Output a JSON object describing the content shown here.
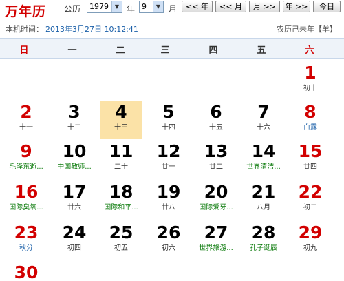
{
  "toolbar": {
    "brand": "万年历",
    "calendar_label": "公历",
    "year_value": "1979",
    "year_label": "年",
    "month_value": "9",
    "month_label": "月",
    "prev_year": "<< 年",
    "prev_month": "<< 月",
    "next_month": "月 >>",
    "next_year": "年 >>",
    "today": "今日"
  },
  "status": {
    "time_label": "本机时间：",
    "time_value": "2013年3月27日 10:12:41",
    "lunar_year": "农历己未年【羊】"
  },
  "weekdays": [
    "日",
    "一",
    "二",
    "三",
    "四",
    "五",
    "六"
  ],
  "colors": {
    "holiday_red": "#d20000",
    "festival_green": "#0a7a0a",
    "solar_term_blue": "#1a5fa8",
    "today_highlight": "#fbe2a7"
  },
  "days": [
    {
      "d": "1",
      "s": "初十"
    },
    {
      "d": "2",
      "s": "十一"
    },
    {
      "d": "3",
      "s": "十二"
    },
    {
      "d": "4",
      "s": "十三"
    },
    {
      "d": "5",
      "s": "十四"
    },
    {
      "d": "6",
      "s": "十五"
    },
    {
      "d": "7",
      "s": "十六"
    },
    {
      "d": "8",
      "s": "白露"
    },
    {
      "d": "9",
      "s": "毛泽东逝..."
    },
    {
      "d": "10",
      "s": "中国教师..."
    },
    {
      "d": "11",
      "s": "二十"
    },
    {
      "d": "12",
      "s": "廿一"
    },
    {
      "d": "13",
      "s": "廿二"
    },
    {
      "d": "14",
      "s": "世界清洁..."
    },
    {
      "d": "15",
      "s": "廿四"
    },
    {
      "d": "16",
      "s": "国际臭氧..."
    },
    {
      "d": "17",
      "s": "廿六"
    },
    {
      "d": "18",
      "s": "国际和平..."
    },
    {
      "d": "19",
      "s": "廿八"
    },
    {
      "d": "20",
      "s": "国际爱牙..."
    },
    {
      "d": "21",
      "s": "八月"
    },
    {
      "d": "22",
      "s": "初二"
    },
    {
      "d": "23",
      "s": "秋分"
    },
    {
      "d": "24",
      "s": "初四"
    },
    {
      "d": "25",
      "s": "初五"
    },
    {
      "d": "26",
      "s": "初六"
    },
    {
      "d": "27",
      "s": "世界旅游..."
    },
    {
      "d": "28",
      "s": "孔子诞辰"
    },
    {
      "d": "29",
      "s": "初九"
    },
    {
      "d": "30",
      "s": ""
    }
  ]
}
